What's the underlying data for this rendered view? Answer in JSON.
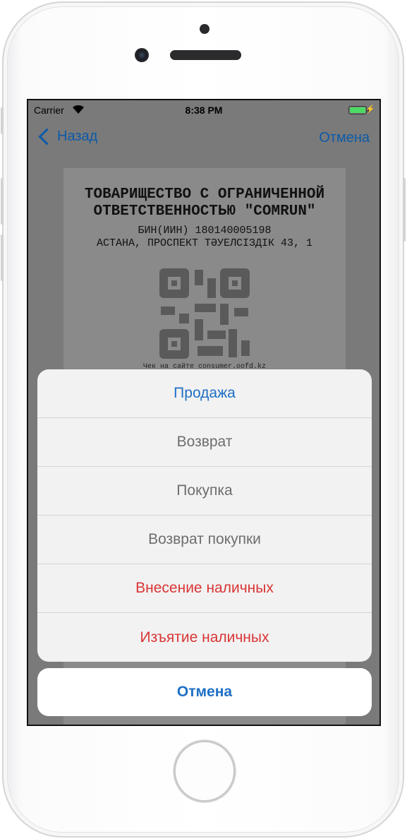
{
  "status_bar": {
    "carrier": "Carrier",
    "time": "8:38 PM",
    "wifi_icon": "wifi-icon",
    "battery_icon": "battery-charging-icon"
  },
  "nav": {
    "back_label": "Назад",
    "cancel_label": "Отмена",
    "back_icon": "chevron-left-icon"
  },
  "receipt": {
    "title_line1": "ТОВАРИЩЕСТВО С ОГРАНИЧЕННОЙ",
    "title_line2": "ОТВЕТСТВЕННОСТЬЮ \"COMRUN\"",
    "bin": "БИН(ИИН) 180140005198",
    "address": "АСТАНА, ПРОСПЕКТ ТӘУЕЛСІЗДІК 43, 1",
    "check_link": "Чек на сайте consumer.oofd.kz"
  },
  "action_sheet": {
    "items": [
      {
        "label": "Продажа",
        "style": "blue"
      },
      {
        "label": "Возврат",
        "style": "gray"
      },
      {
        "label": "Покупка",
        "style": "gray"
      },
      {
        "label": "Возврат покупки",
        "style": "gray"
      },
      {
        "label": "Внесение наличных",
        "style": "red"
      },
      {
        "label": "Изъятие наличных",
        "style": "red"
      }
    ],
    "cancel_label": "Отмена"
  },
  "colors": {
    "accent_blue": "#1f6fc4",
    "destructive_red": "#d93535",
    "battery_green": "#4cd964"
  }
}
